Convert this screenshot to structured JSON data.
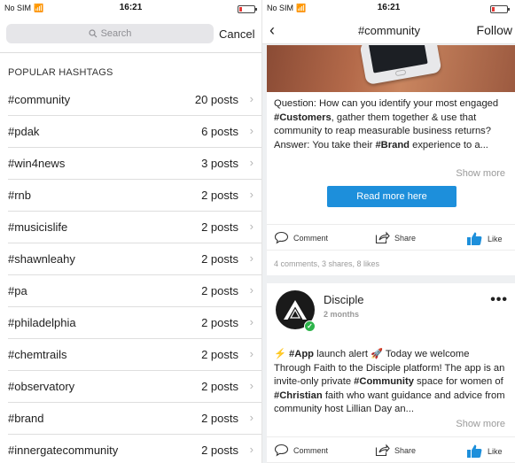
{
  "left": {
    "status": {
      "carrier": "No SIM",
      "time": "16:21"
    },
    "search": {
      "placeholder": "Search",
      "cancel_label": "Cancel"
    },
    "section_title": "POPULAR HASHTAGS",
    "hashtags": [
      {
        "tag": "#community",
        "count": "20 posts"
      },
      {
        "tag": "#pdak",
        "count": "6 posts"
      },
      {
        "tag": "#win4news",
        "count": "3 posts"
      },
      {
        "tag": "#rnb",
        "count": "2 posts"
      },
      {
        "tag": "#musicislife",
        "count": "2 posts"
      },
      {
        "tag": "#shawnleahy",
        "count": "2 posts"
      },
      {
        "tag": "#pa",
        "count": "2 posts"
      },
      {
        "tag": "#philadelphia",
        "count": "2 posts"
      },
      {
        "tag": "#chemtrails",
        "count": "2 posts"
      },
      {
        "tag": "#observatory",
        "count": "2 posts"
      },
      {
        "tag": "#brand",
        "count": "2 posts"
      },
      {
        "tag": "#innergatecommunity",
        "count": "2 posts"
      }
    ]
  },
  "right": {
    "status": {
      "carrier": "No SIM",
      "time": "16:21"
    },
    "nav": {
      "title": "#community",
      "follow_label": "Follow"
    },
    "post1": {
      "text": [
        {
          "t": "Question: How can you identify your most engaged "
        },
        {
          "t": "#Customers",
          "b": true
        },
        {
          "t": ", gather them together & use that community to reap measurable business returns?"
        },
        {
          "br": true
        },
        {
          "t": "Answer: You take their "
        },
        {
          "t": "#Brand",
          "b": true
        },
        {
          "t": " experience to a..."
        }
      ],
      "show_more": "Show more",
      "read_more": "Read more here",
      "comment_label": "Comment",
      "share_label": "Share",
      "like_label": "Like",
      "stats": "4 comments, 3 shares, 8 likes"
    },
    "post2": {
      "author": "Disciple",
      "posted": "2 months",
      "text": [
        {
          "t": "⚡ "
        },
        {
          "t": "#App",
          "b": true
        },
        {
          "t": " launch alert 🚀 Today we welcome Through Faith to the Disciple platform! The app is an invite-only private "
        },
        {
          "t": "#Community",
          "b": true
        },
        {
          "t": " space for women of "
        },
        {
          "t": "#Christian",
          "b": true
        },
        {
          "t": " faith who want guidance and advice from community host Lillian Day an..."
        }
      ],
      "show_more": "Show more",
      "comment_label": "Comment",
      "share_label": "Share",
      "like_label": "Like"
    }
  },
  "colors": {
    "accent": "#1d8fdb",
    "verified": "#2db34a",
    "battery_low": "#e53935"
  }
}
